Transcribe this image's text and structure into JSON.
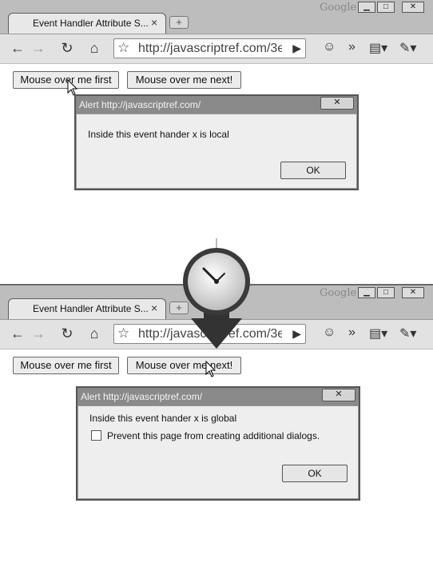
{
  "windows": [
    {
      "tab_title": "Event Handler Attribute S...",
      "google_logo": "Google",
      "url": "http://javascriptref.com/3e",
      "buttons": {
        "first": "Mouse over me first",
        "next": "Mouse over me next!"
      },
      "alert": {
        "title": "Alert http://javascriptref.com/",
        "message": "Inside this event hander x is local",
        "ok": "OK"
      }
    },
    {
      "tab_title": "Event Handler Attribute S...",
      "google_logo": "Google",
      "url": "http://javascriptref.com/3e",
      "buttons": {
        "first": "Mouse over me first",
        "next": "Mouse over me next!"
      },
      "alert": {
        "title": "Alert http://javascriptref.com/",
        "message": "Inside this event hander x is global",
        "checkbox_label": "Prevent this page from creating additional dialogs.",
        "ok": "OK"
      }
    }
  ],
  "icons": {
    "back": "back-arrow-icon",
    "forward": "forward-arrow-icon",
    "reload": "reload-icon",
    "home": "home-icon",
    "star": "bookmark-star-icon",
    "go": "go-arrow-icon",
    "page": "page-menu-icon",
    "wrench": "wrench-menu-icon",
    "clock": "clock-icon",
    "cursor": "mouse-pointer-icon"
  }
}
